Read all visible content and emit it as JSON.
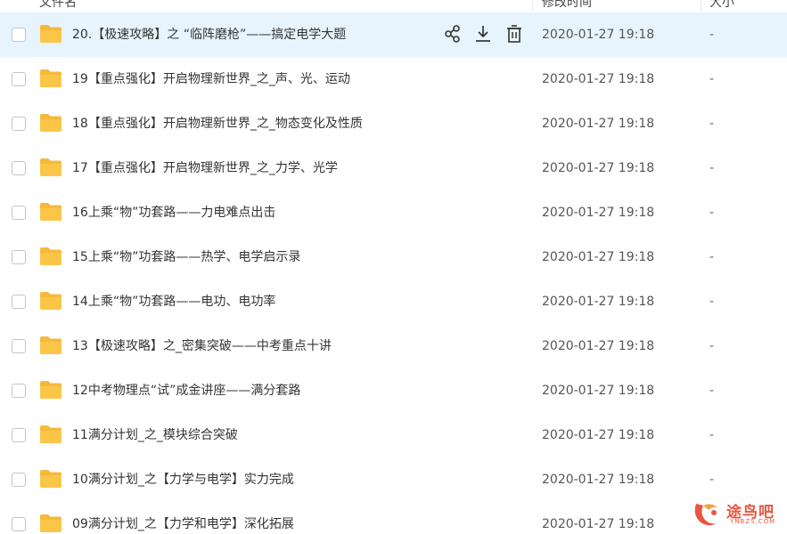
{
  "header": {
    "name_col": "文件名",
    "time_col": "修改时间",
    "size_col": "大小"
  },
  "rows": [
    {
      "name": "20.【极速攻略】之 “临阵磨枪”——搞定电学大题",
      "time": "2020-01-27 19:18",
      "size": "-"
    },
    {
      "name": "19【重点强化】开启物理新世界_之_声、光、运动",
      "time": "2020-01-27 19:18",
      "size": "-"
    },
    {
      "name": "18【重点强化】开启物理新世界_之_物态变化及性质",
      "time": "2020-01-27 19:18",
      "size": "-"
    },
    {
      "name": "17【重点强化】开启物理新世界_之_力学、光学",
      "time": "2020-01-27 19:18",
      "size": "-"
    },
    {
      "name": "16上乘“物”功套路——力电难点出击",
      "time": "2020-01-27 19:18",
      "size": "-"
    },
    {
      "name": "15上乘“物”功套路——热学、电学启示录",
      "time": "2020-01-27 19:18",
      "size": "-"
    },
    {
      "name": "14上乘“物”功套路——电功、电功率",
      "time": "2020-01-27 19:18",
      "size": "-"
    },
    {
      "name": "13【极速攻略】之_密集突破——中考重点十讲",
      "time": "2020-01-27 19:18",
      "size": "-"
    },
    {
      "name": "12中考物理点“试”成金讲座——满分套路",
      "time": "2020-01-27 19:18",
      "size": "-"
    },
    {
      "name": "11满分计划_之_模块综合突破",
      "time": "2020-01-27 19:18",
      "size": "-"
    },
    {
      "name": "10满分计划_之【力学与电学】实力完成",
      "time": "2020-01-27 19:18",
      "size": "-"
    },
    {
      "name": "09满分计划_之【力学和电学】深化拓展",
      "time": "2020-01-27 19:18",
      "size": "-"
    }
  ],
  "icons": {
    "folder": "folder-icon",
    "share": "share-icon",
    "download": "download-icon",
    "delete": "trash-icon"
  },
  "watermark": {
    "cn": "途鸟吧",
    "en": "YNBZS.COM"
  },
  "colors": {
    "highlight_row": "#e8f4fd",
    "folder": "#f6b93b",
    "watermark": "#e8472e"
  }
}
